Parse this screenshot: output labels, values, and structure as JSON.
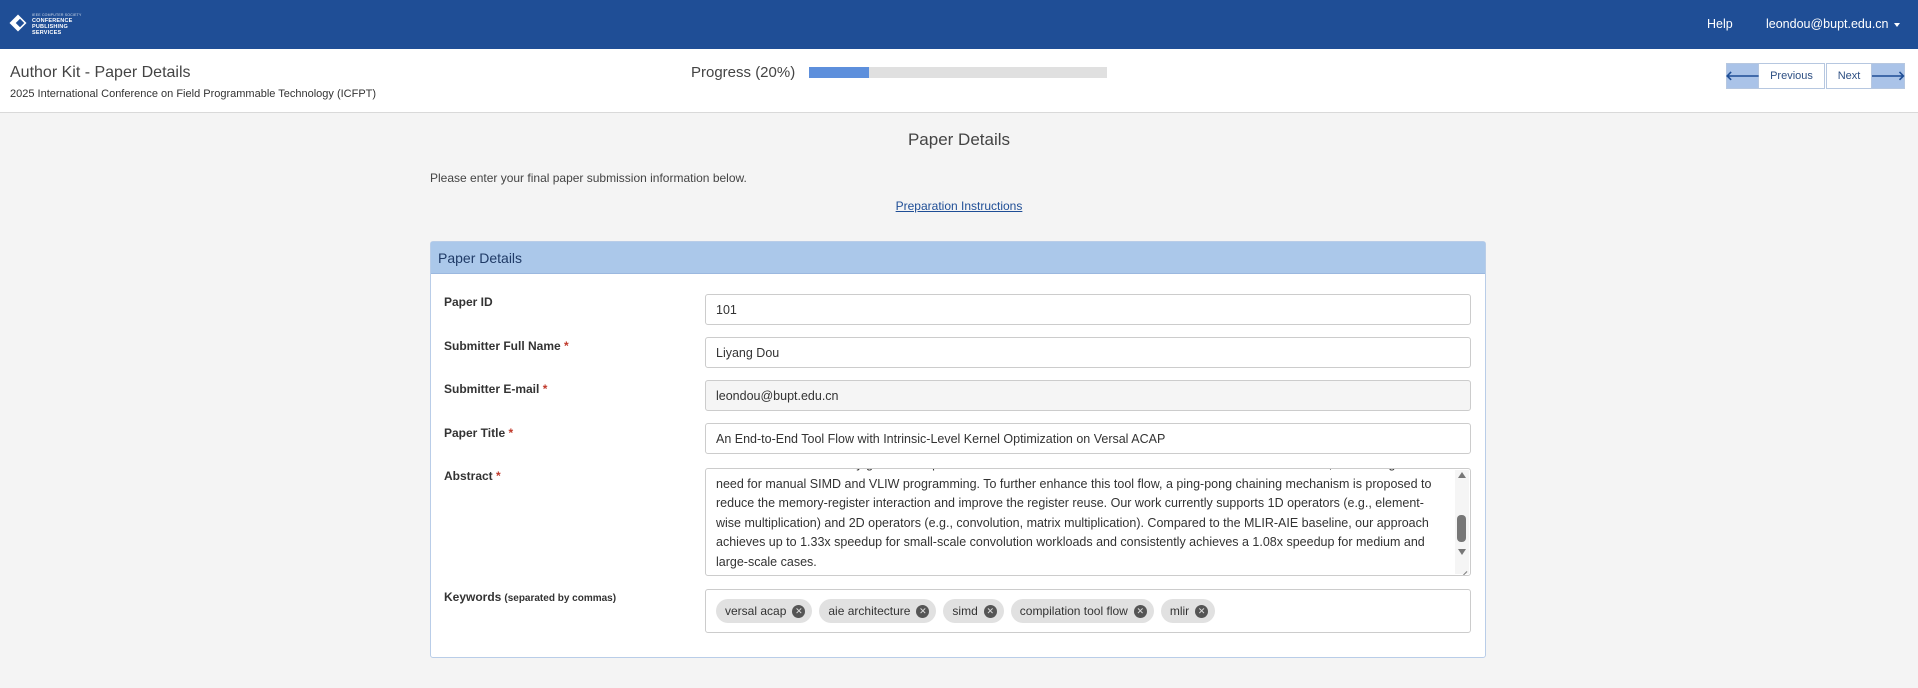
{
  "navbar": {
    "logo_text_top": "IEEE COMPUTER SOCIETY",
    "logo_text_lines": [
      "CONFERENCE",
      "PUBLISHING",
      "SERVICES"
    ],
    "help": "Help",
    "user": "leondou@bupt.edu.cn"
  },
  "subheader": {
    "title": "Author Kit - Paper Details",
    "conference": "2025 International Conference on Field Programmable Technology (ICFPT)",
    "progress_label": "Progress (20%)",
    "progress_value": 0.2,
    "prev_label": "Previous",
    "next_label": "Next"
  },
  "main": {
    "title": "Paper Details",
    "intro": "Please enter your final paper submission information below.",
    "prep_link": "Preparation Instructions"
  },
  "card": {
    "header": "Paper Details",
    "fields": {
      "paper_id": {
        "label": "Paper ID",
        "value": "101"
      },
      "submitter_name": {
        "label": "Submitter Full Name",
        "required": "*",
        "value": "Liyang Dou"
      },
      "submitter_email": {
        "label": "Submitter E-mail",
        "required": "*",
        "value": "leondou@bupt.edu.cn"
      },
      "paper_title": {
        "label": "Paper Title",
        "required": "*",
        "value": "An End-to-End Tool Flow with Intrinsic-Level Kernel Optimization on Versal ACAP"
      },
      "abstract": {
        "label": "Abstract",
        "required": "*",
        "value": "tool flow that automatically generates optimized AIE kernels from C++ code. It is based on the MLIR framework, eliminating the need for manual SIMD and VLIW programming. To further enhance this tool flow, a ping-pong chaining mechanism is proposed to reduce the memory-register interaction and improve the register reuse. Our work currently supports 1D operators (e.g., element-wise multiplication) and 2D operators (e.g., convolution, matrix multiplication). Compared to the MLIR-AIE baseline, our approach achieves up to 1.33x speedup for small-scale convolution workloads and consistently achieves a 1.08x speedup for medium and large-scale cases."
      },
      "keywords": {
        "label": "Keywords",
        "hint": "(separated by commas)",
        "tags": [
          "versal acap",
          "aie architecture",
          "simd",
          "compilation tool flow",
          "mlir"
        ]
      }
    }
  },
  "colors": {
    "navbar": "#1f4e96",
    "card_header": "#abc8ea",
    "progress_fill": "#5d8fdc",
    "required": "#c0392b"
  },
  "icons": {
    "prev": "arrow-left-icon",
    "next": "arrow-right-icon",
    "tag_remove": "remove-circle-icon",
    "caret": "caret-down-icon"
  }
}
